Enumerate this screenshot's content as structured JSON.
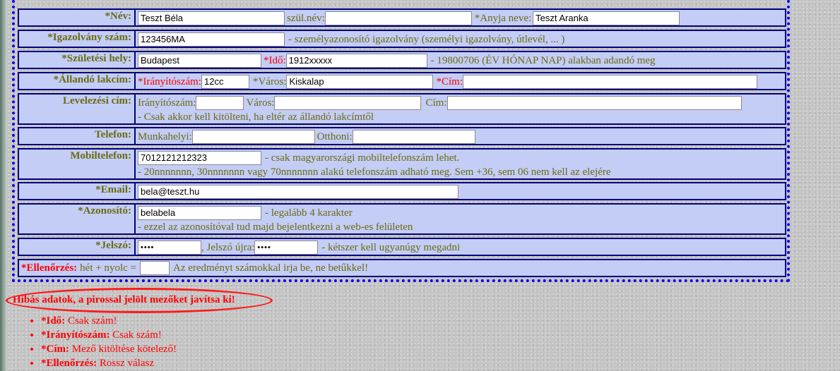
{
  "fields": {
    "nev": {
      "label": "*Név:",
      "value": "Teszt Béla",
      "szulnev_label": "szül.név:",
      "szulnev_value": "",
      "anyja_label": "*Anyja neve:",
      "anyja_value": "Teszt Aranka"
    },
    "igazolvany": {
      "label": "*Igazolvány szám:",
      "value": "123456MA",
      "hint": "- személyazonosító igazolvány (személyi igazolvány, útlevél, ... )"
    },
    "szuletesi": {
      "label": "*Születési hely:",
      "value": "Budapest",
      "ido_label": "*Idő:",
      "ido_value": "1912xxxxx",
      "hint": "- 19800706 (ÉV HÓNAP NAP) alakban adandó meg"
    },
    "allando": {
      "label": "*Állandó lakcím:",
      "irsz_label": "*Irányítószám:",
      "irsz_value": "12cc",
      "varos_label": "*Város:",
      "varos_value": "Kiskalap",
      "cim_label": "*Cím:",
      "cim_value": ""
    },
    "levelezesi": {
      "label": "Levelezési cím:",
      "irsz_label": "Irányítószám:",
      "irsz_value": "",
      "varos_label": "Város:",
      "varos_value": "",
      "cim_label": "Cím:",
      "cim_value": "",
      "hint": "- Csak akkor kell kitölteni, ha eltér az állandó lakcímtől"
    },
    "telefon": {
      "label": "Telefon:",
      "munka_label": "Munkahelyi:",
      "munka_value": "",
      "otthoni_label": "Otthoni:",
      "otthoni_value": ""
    },
    "mobil": {
      "label": "Mobiltelefon:",
      "value": "7012121212323",
      "hint1": "- csak magyarországi mobiltelefonszám lehet.",
      "hint2": "- 20nnnnnnn, 30nnnnnnn vagy 70nnnnnnn alakú telefonszám adható meg. Sem +36, sem 06 nem kell az elejére"
    },
    "email": {
      "label": "*Email:",
      "value": "bela@teszt.hu"
    },
    "azonosito": {
      "label": "*Azonosító:",
      "value": "belabela",
      "hint1": "- legalább 4 karakter",
      "hint2": "- ezzel az azonosítóval tud majd bejelentkezni a web-es felületen"
    },
    "jelszo": {
      "label": "*Jelszó:",
      "value": "••••",
      "ujra_label": ", Jelszó újra:",
      "ujra_value": "••••",
      "hint": "- kétszer kell ugyanúgy megadni"
    },
    "ellenorzes": {
      "label": "*Ellenőrzés:",
      "question": "hét + nyolc =",
      "value": "",
      "hint": "Az eredményt számokkal irja be, ne betűkkel!"
    }
  },
  "errors": {
    "title": "Hibás adatok, a pirossal jelölt mezőket javítsa ki!",
    "items": [
      {
        "field": "*Idő:",
        "msg": "Csak szám!"
      },
      {
        "field": "*Irányítószám:",
        "msg": "Csak szám!"
      },
      {
        "field": "*Cím:",
        "msg": "Mező kitöltése kötelező!"
      },
      {
        "field": "*Ellenőrzés:",
        "msg": "Rossz válasz"
      }
    ]
  },
  "colors": {
    "row_bg": "#c3cdf6",
    "border": "#000080",
    "frame": "#0000ff",
    "label": "#6b6b10",
    "error": "#ff0000"
  }
}
